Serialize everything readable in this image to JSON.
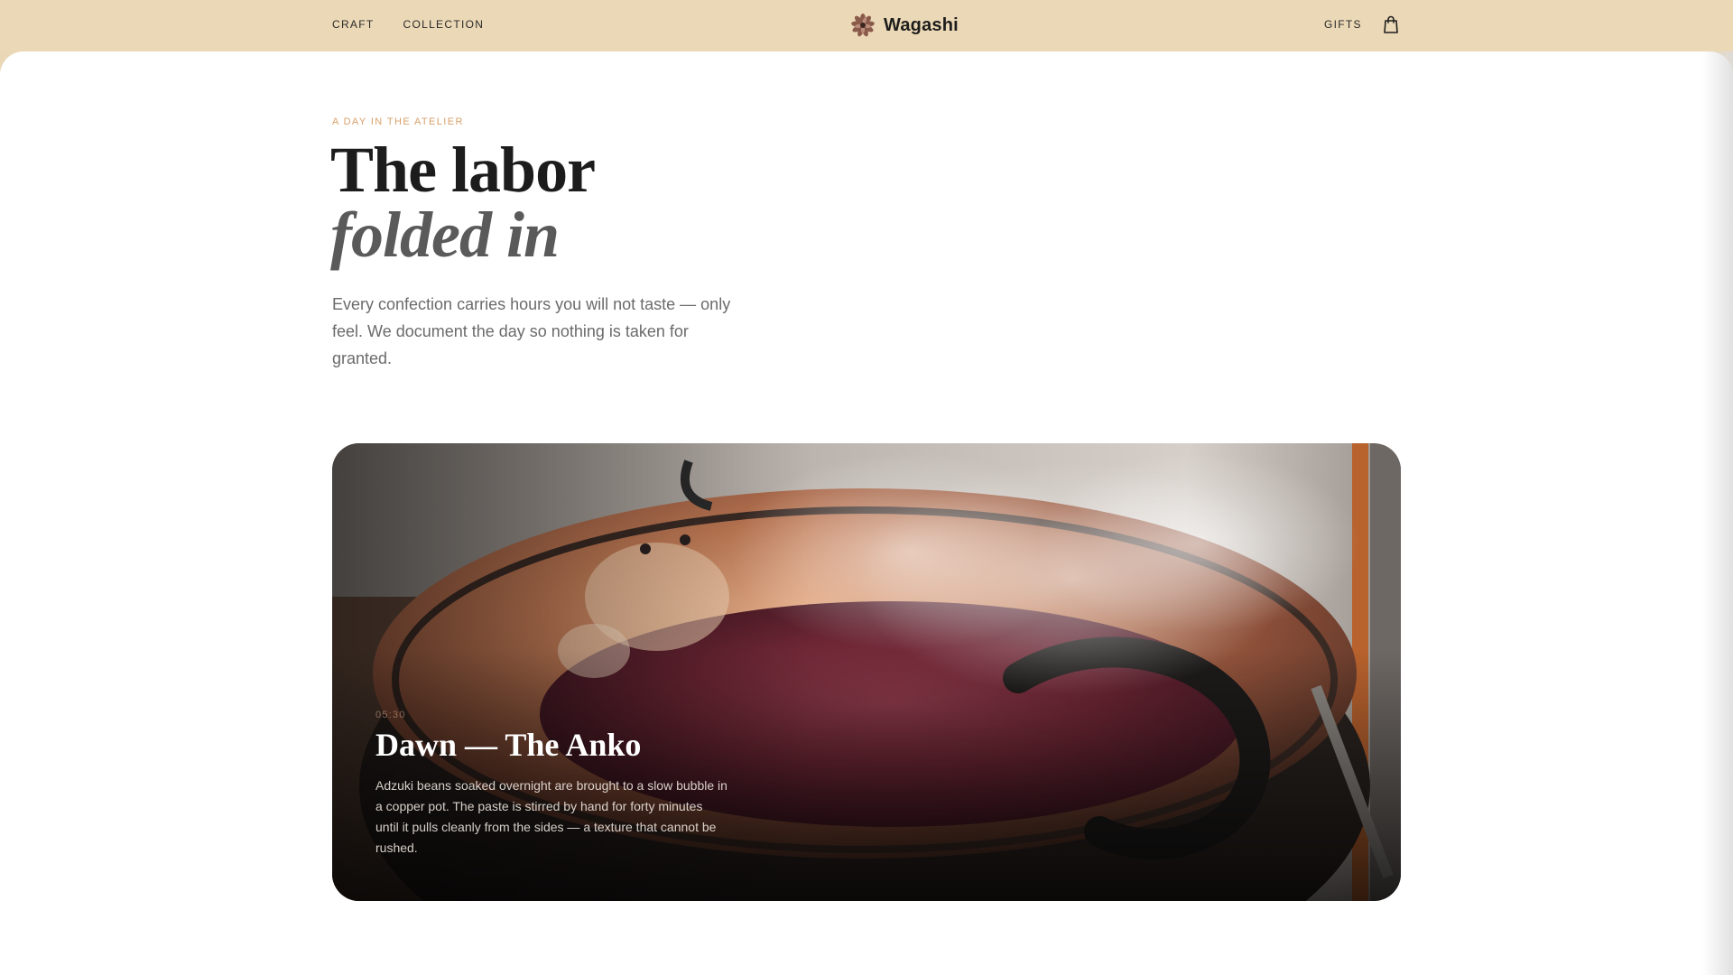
{
  "header": {
    "nav_left": [
      "CRAFT",
      "COLLECTION"
    ],
    "brand": "Wagashi",
    "nav_right": "GIFTS",
    "bag_icon": "shopping-bag-icon",
    "background": "#ebd8b6"
  },
  "intro": {
    "eyebrow": "A DAY IN THE ATELIER",
    "title_line1": "The labor",
    "title_line2": "folded in",
    "lede": "Every confection carries hours you will not taste — only feel. We document the day so nothing is taken for granted."
  },
  "hero_card": {
    "time": "05:30",
    "title": "Dawn — The Anko",
    "text": "Adzuki beans soaked overnight are brought to a slow bubble in a copper pot. The paste is stirred by hand for forty minutes until it pulls cleanly from the sides — a texture that cannot be rushed."
  },
  "colors": {
    "accent": "#d9a06a",
    "copper": "#b06a3e",
    "anko": "#5e1f2a"
  }
}
